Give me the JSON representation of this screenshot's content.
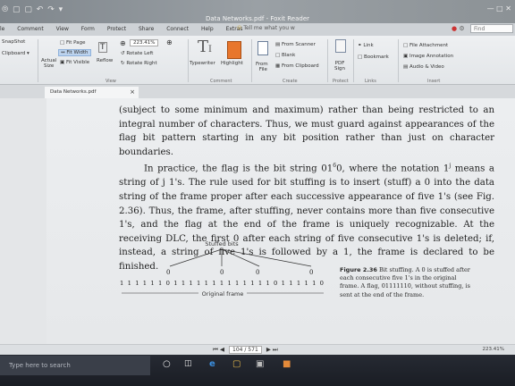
{
  "titlebar": {
    "title": "Data Networks.pdf - Foxit Reader",
    "qat": "⦾ ▢ ▢ ↶ ↷ ▾"
  },
  "menu": {
    "items": [
      "le",
      "Comment",
      "View",
      "Form",
      "Protect",
      "Share",
      "Connect",
      "Help",
      "Extras"
    ],
    "tellme": "Tell me what you w",
    "find_placeholder": "Find"
  },
  "ribbon": {
    "snapshot": "SnapShot",
    "clipboard": "Clipboard ▾",
    "fit_page": "Fit Page",
    "fit_width": "Fit Width",
    "fit_visible": "Fit Visible",
    "actual_size": "Actual",
    "actual_size2": "Size",
    "reflow": "Reflow",
    "zoom": "223.41%",
    "rotate_left": "Rotate Left",
    "rotate_right": "Rotate Right",
    "typewriter": "Typewriter",
    "highlight": "Highlight",
    "from_file": "From",
    "from_file2": "File",
    "from_scanner": "From Scanner",
    "blank": "Blank",
    "from_clipboard": "From Clipboard",
    "pdf_sign": "PDF",
    "pdf_sign2": "Sign",
    "link": "Link",
    "bookmark": "Bookmark",
    "file_attachment": "File Attachment",
    "image_annotation": "Image Annotation",
    "audio_video": "Audio & Video",
    "groups": {
      "view": "View",
      "comment": "Comment",
      "create": "Create",
      "protect": "Protect",
      "links": "Links",
      "insert": "Insert"
    }
  },
  "document_tab": {
    "name": "Data Networks.pdf"
  },
  "body": {
    "p1": "(subject to some minimum and maximum) rather than being restricted to an integral number of characters. Thus, we must guard against appearances of the flag bit pattern starting in any bit position rather than just on character boundaries.",
    "p2a": "In practice, the flag is the bit string 01",
    "p2sup1": "6",
    "p2b": "0, where the notation 1",
    "p2sup2": "j",
    "p2c": " means a string of j 1's. The rule used for bit stuffing is to insert (stuff) a 0 into the data string of the frame proper after each successive appearance of five 1's (see Fig. 2.36). Thus, the frame, after stuffing, never contains more than five consecutive 1's, and the flag at the end of the frame is uniquely recognizable. At the receiving DLC, the first 0 after each string of five consecutive 1's is deleted; if, instead, a string of five 1's is followed by a 1, the frame is declared to be finished."
  },
  "figure": {
    "label_stuffed": "Stuffed bits",
    "bits": "1 1 1 1 1 1 0 1 1 1 1 1 1 1 1 1 1 1 1 1 0 1 1 1 1 1 0",
    "zero": "0",
    "label_frame": "Original frame",
    "caption_num": "Figure 2.36",
    "caption_text": "Bit stuffing. A 0 is stuffed after each consecutive five 1's in the original frame. A flag, 01111110, without stuffing, is sent at the end of the frame."
  },
  "statusbar": {
    "page": "104 / 571",
    "zoom": "223.41%"
  },
  "taskbar": {
    "search_placeholder": "Type here to search"
  },
  "colors": {
    "highlight_btn": "#e8762c",
    "accent": "#1a4fa0",
    "taskbar": "#1f232b"
  }
}
